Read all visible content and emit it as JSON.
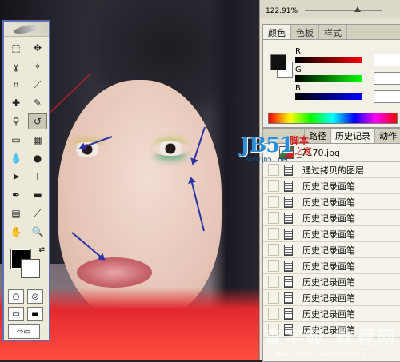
{
  "toolbox": {
    "tools": [
      {
        "name": "marquee-tool",
        "glyph": "⬚"
      },
      {
        "name": "move-tool",
        "glyph": "✥"
      },
      {
        "name": "lasso-tool",
        "glyph": "ɣ"
      },
      {
        "name": "magic-wand-tool",
        "glyph": "✧"
      },
      {
        "name": "crop-tool",
        "glyph": "⌗"
      },
      {
        "name": "slice-tool",
        "glyph": "⟋"
      },
      {
        "name": "healing-brush-tool",
        "glyph": "✚"
      },
      {
        "name": "brush-tool",
        "glyph": "✎"
      },
      {
        "name": "clone-stamp-tool",
        "glyph": "⚲"
      },
      {
        "name": "history-brush-tool",
        "glyph": "↺"
      },
      {
        "name": "eraser-tool",
        "glyph": "▭"
      },
      {
        "name": "gradient-tool",
        "glyph": "▦"
      },
      {
        "name": "blur-tool",
        "glyph": "💧"
      },
      {
        "name": "dodge-tool",
        "glyph": "●"
      },
      {
        "name": "path-selection-tool",
        "glyph": "➤"
      },
      {
        "name": "type-tool",
        "glyph": "T"
      },
      {
        "name": "pen-tool",
        "glyph": "✒"
      },
      {
        "name": "shape-tool",
        "glyph": "▬"
      },
      {
        "name": "notes-tool",
        "glyph": "▤"
      },
      {
        "name": "eyedropper-tool",
        "glyph": "⟋"
      },
      {
        "name": "hand-tool",
        "glyph": "✋"
      },
      {
        "name": "zoom-tool",
        "glyph": "🔍"
      }
    ],
    "selected_tool": "history-brush-tool"
  },
  "navigator": {
    "zoom": "122.91%"
  },
  "color_panel": {
    "tabs": [
      "颜色",
      "色板",
      "样式"
    ],
    "active_tab": "颜色",
    "sliders": [
      {
        "label": "R",
        "gradient": "linear-gradient(90deg,#000,#f00)"
      },
      {
        "label": "G",
        "gradient": "linear-gradient(90deg,#000,#0f0)"
      },
      {
        "label": "B",
        "gradient": "linear-gradient(90deg,#000,#00f)"
      }
    ],
    "foreground": "#111111",
    "background": "#ffffff"
  },
  "history_panel": {
    "tabs": [
      "路径",
      "历史记录",
      "动作"
    ],
    "active_tab": "历史记录",
    "snapshot": "_7170.jpg",
    "items": [
      "通过拷贝的图层",
      "历史记录画笔",
      "历史记录画笔",
      "历史记录画笔",
      "历史记录画笔",
      "历史记录画笔",
      "历史记录画笔",
      "历史记录画笔",
      "历史记录画笔",
      "历史记录画笔",
      "历史记录画笔"
    ]
  },
  "watermark": {
    "logo": "JB51",
    "logo_url": "www.jb51.net",
    "cn_top": "脚本",
    "cn_bottom": "之家",
    "site_cn": "查字典 教程网",
    "site_url": "jiaocheng.chazidian.com"
  },
  "colors": {
    "arrow": "#2b33a6",
    "toolbox_border": "#5a6fb8",
    "panel_bg": "#e6e3d4"
  }
}
